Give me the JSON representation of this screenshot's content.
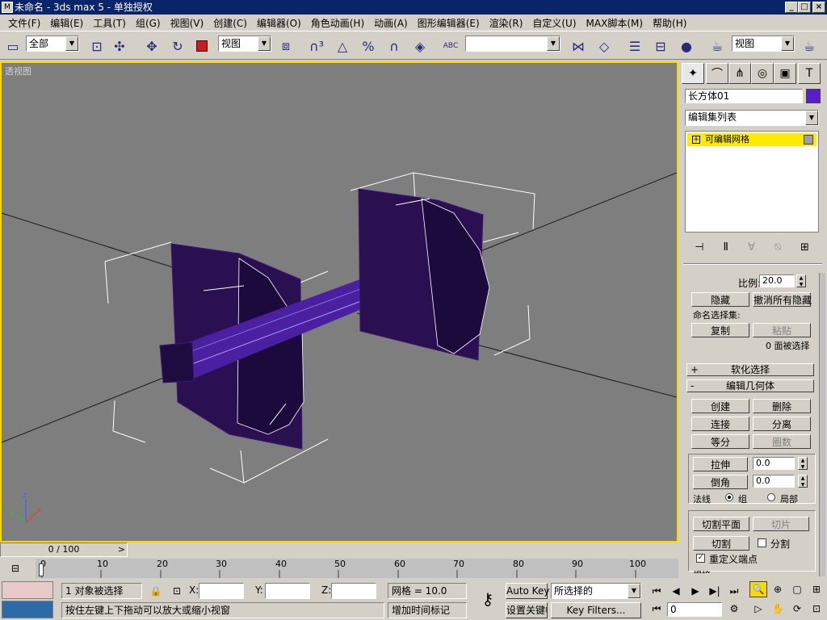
{
  "window": {
    "title": "未命名 - 3ds max 5 - 单独授权",
    "icon_text": "M",
    "min": "_",
    "max": "□",
    "close": "×"
  },
  "menu": [
    "文件(F)",
    "编辑(E)",
    "工具(T)",
    "组(G)",
    "视图(V)",
    "创建(C)",
    "编辑器(O)",
    "角色动画(H)",
    "动画(A)",
    "图形编辑器(E)",
    "渲染(R)",
    "自定义(U)",
    "MAX脚本(M)",
    "帮助(H)"
  ],
  "toolbar": {
    "selection_filter": "全部",
    "ref_coord": "视图",
    "named_sel": "",
    "render_view": "视图",
    "abc_label": "ABC"
  },
  "viewport": {
    "label": "透视图",
    "axis_x": "x",
    "axis_y": "y",
    "axis_z": "z"
  },
  "panel": {
    "object_name": "长方体01",
    "object_color": "#5a1ec8",
    "modifier_list": "编辑集列表",
    "stack_item": "可编辑网格",
    "scale_label": "比例:",
    "scale_value": "20.0",
    "hide": "隐藏",
    "unhide_all": "撤消所有隐藏",
    "named_sel": "命名选择集:",
    "copy": "复制",
    "paste": "粘贴",
    "selected_faces": "0 面被选择",
    "soft_sel": "软化选择",
    "edit_geom": "编辑几何体",
    "plus": "+",
    "minus": "-",
    "create": "创建",
    "delete": "删除",
    "attach": "连接",
    "detach": "分离",
    "divide": "等分",
    "turn": "圈数",
    "extrude": "拉伸",
    "extrude_val": "0.0",
    "bevel": "倒角",
    "bevel_val": "0.0",
    "normal_label": "法线",
    "group": "组",
    "local": "局部",
    "slice_plane": "切割平面",
    "slice": "切片",
    "cut": "切割",
    "split": "分割",
    "refine_ends": "重定义端点",
    "more": "焊接"
  },
  "timeline": {
    "position": "0 / 100",
    "ticks": [
      "0",
      "10",
      "20",
      "30",
      "40",
      "50",
      "60",
      "70",
      "80",
      "90",
      "100"
    ]
  },
  "status": {
    "selected": "1 对象被选择",
    "x_label": "X:",
    "y_label": "Y:",
    "z_label": "Z:",
    "grid": "网格 = 10.0",
    "prompt": "按住左键上下拖动可以放大或缩小视窗",
    "add_time_tag": "增加时间标记",
    "auto_key": "Auto Key",
    "set_key": "设置关键帧",
    "key_mode": "所选择的",
    "key_filters": "Key Filters...",
    "frame": "0"
  }
}
